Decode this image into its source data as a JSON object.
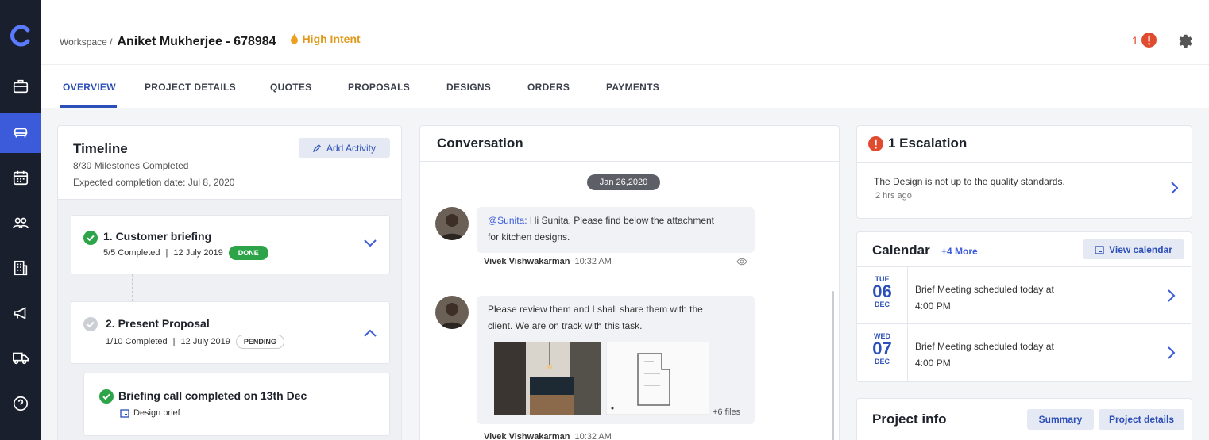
{
  "breadcrumb": {
    "workspace": "Workspace /",
    "name": "Aniket Mukherjee - 678984",
    "intent": "High Intent"
  },
  "header": {
    "alert_count": "1"
  },
  "tabs": [
    {
      "label": "OVERVIEW",
      "active": true
    },
    {
      "label": "PROJECT DETAILS"
    },
    {
      "label": "QUOTES"
    },
    {
      "label": "PROPOSALS"
    },
    {
      "label": "DESIGNS"
    },
    {
      "label": "ORDERS"
    },
    {
      "label": "PAYMENTS"
    }
  ],
  "timeline": {
    "title": "Timeline",
    "milestones_completed": "8/30 Milestones Completed",
    "expected_date": "Expected completion date: Jul 8, 2020",
    "add_activity": "Add Activity",
    "milestones": [
      {
        "title": "1.  Customer briefing",
        "progress": "5/5 Completed",
        "date": "12 July 2019",
        "status": "DONE"
      },
      {
        "title": "2.  Present Proposal",
        "progress": "1/10 Completed",
        "date": "12 July 2019",
        "status": "PENDING"
      }
    ],
    "activity": {
      "title": "Briefing call completed on 13th Dec",
      "tag": "Design brief"
    }
  },
  "conversation": {
    "title": "Conversation",
    "date": "Jan 26,2020",
    "messages": [
      {
        "mention": "@Sunita:",
        "line1": " Hi Sunita, Please find below the attachment",
        "line2": "for kitchen designs.",
        "sender": "Vivek Vishwakarman",
        "time": "10:32 AM"
      },
      {
        "line1": "Please review them and I shall share them with the",
        "line2": "client. We are on track with this task.",
        "files_more": "+6 files",
        "sender": "Vivek Vishwakarman",
        "time": "10:32 AM"
      }
    ]
  },
  "escalation": {
    "title": "1 Escalation",
    "text": "The Design is not up to the quality standards.",
    "time": "2 hrs ago"
  },
  "calendar": {
    "title": "Calendar",
    "more": "+4 More",
    "view": "View calendar",
    "events": [
      {
        "dow": "TUE",
        "day": "06",
        "month": "DEC",
        "line1": "Brief Meeting scheduled today at",
        "line2": "4:00 PM"
      },
      {
        "dow": "WED",
        "day": "07",
        "month": "DEC",
        "line1": "Brief Meeting scheduled today at",
        "line2": "4:00 PM"
      }
    ]
  },
  "project_info": {
    "title": "Project info",
    "summary": "Summary",
    "details": "Project details"
  },
  "colors": {
    "sidebar": "#1a1f2e",
    "accent": "#3b5bdb",
    "done": "#2da447",
    "alert": "#e04a2f",
    "intent": "#e09a1b"
  }
}
